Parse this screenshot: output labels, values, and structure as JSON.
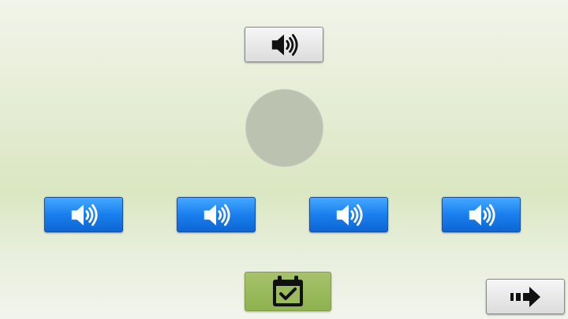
{
  "colors": {
    "background_top": "#f1f4ea",
    "background_mid": "#dae7c2",
    "button_gray": "#e8e8e8",
    "button_blue": "#1a7fee",
    "button_green": "#8fb24f",
    "circle_placeholder": "#bcc2b0"
  },
  "top_sound_button": {
    "icon": "speaker-icon"
  },
  "picture_placeholder": {
    "icon": "none"
  },
  "options": [
    {
      "icon": "speaker-icon"
    },
    {
      "icon": "speaker-icon"
    },
    {
      "icon": "speaker-icon"
    },
    {
      "icon": "speaker-icon"
    }
  ],
  "check_button": {
    "icon": "calendar-check-icon"
  },
  "next_button": {
    "icon": "arrow-right-icon"
  }
}
